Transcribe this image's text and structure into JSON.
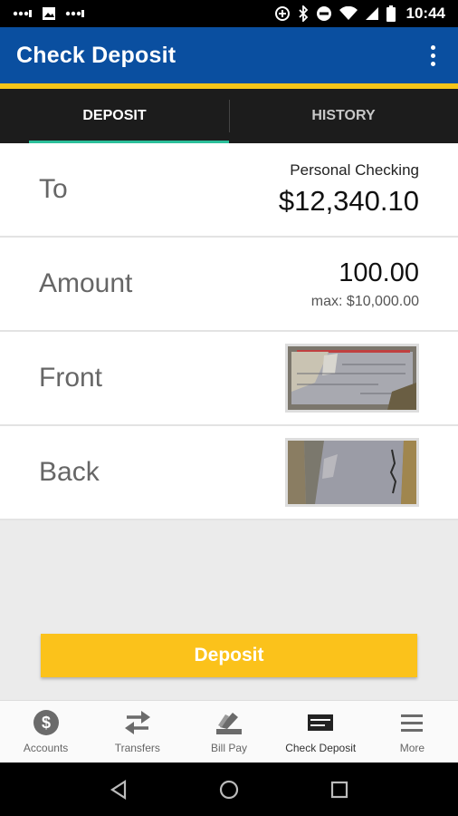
{
  "status_bar": {
    "time": "10:44",
    "icons": [
      "signal-dots-icon",
      "image-icon",
      "signal-dots-icon",
      "data-saver-icon",
      "bluetooth-icon",
      "do-not-disturb-icon",
      "wifi-icon",
      "cell-signal-icon",
      "battery-icon"
    ]
  },
  "app_bar": {
    "title": "Check Deposit",
    "menu_icon": "overflow-menu-icon",
    "colors": {
      "primary": "#0a4fa0",
      "accent": "#f5c518"
    }
  },
  "tabs": [
    {
      "label": "DEPOSIT",
      "active": true
    },
    {
      "label": "HISTORY",
      "active": false
    }
  ],
  "form": {
    "to": {
      "label": "To",
      "account_name": "Personal Checking",
      "balance": "$12,340.10"
    },
    "amount": {
      "label": "Amount",
      "value": "100.00",
      "max": "max: $10,000.00"
    },
    "front": {
      "label": "Front",
      "image": "check-front-photo"
    },
    "back": {
      "label": "Back",
      "image": "check-back-photo"
    }
  },
  "deposit_button": {
    "label": "Deposit",
    "color": "#fbc21b"
  },
  "bottom_nav": [
    {
      "label": "Accounts",
      "icon": "dollar-circle-icon"
    },
    {
      "label": "Transfers",
      "icon": "transfer-arrows-icon"
    },
    {
      "label": "Bill Pay",
      "icon": "bill-pay-icon"
    },
    {
      "label": "Check Deposit",
      "icon": "check-deposit-icon",
      "active": true
    },
    {
      "label": "More",
      "icon": "menu-icon"
    }
  ],
  "system_nav": [
    "back-icon",
    "home-icon",
    "recents-icon"
  ]
}
